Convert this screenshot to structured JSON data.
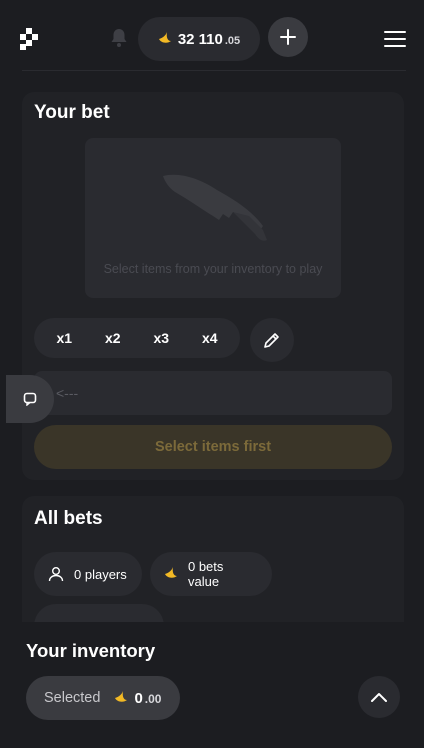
{
  "header": {
    "logo_icon": "pinwheel-logo-icon",
    "bell_icon": "bell-icon",
    "balance": {
      "main": "32 110",
      "cents": ".05",
      "icon": "banana-coin-icon"
    },
    "add_icon": "plus-icon",
    "menu_icon": "hamburger-menu-icon"
  },
  "bet": {
    "title": "Your bet",
    "empty_text": "Select items from your inventory to play",
    "multipliers": [
      "x1",
      "x2",
      "x3",
      "x4"
    ],
    "edit_icon": "pencil-icon",
    "amount_placeholder": "<---",
    "submit_label": "Select items first"
  },
  "all_bets": {
    "title": "All bets",
    "players": "0 players",
    "bets_value": "0 bets value"
  },
  "inventory": {
    "title": "Your inventory",
    "selected_label": "Selected",
    "selected_main": "0",
    "selected_cents": ".00"
  },
  "colors": {
    "background": "#1c1d21",
    "card": "#212226",
    "control": "#2a2b30",
    "coin": "#f2b925",
    "disabled_button": "#3a3528"
  }
}
